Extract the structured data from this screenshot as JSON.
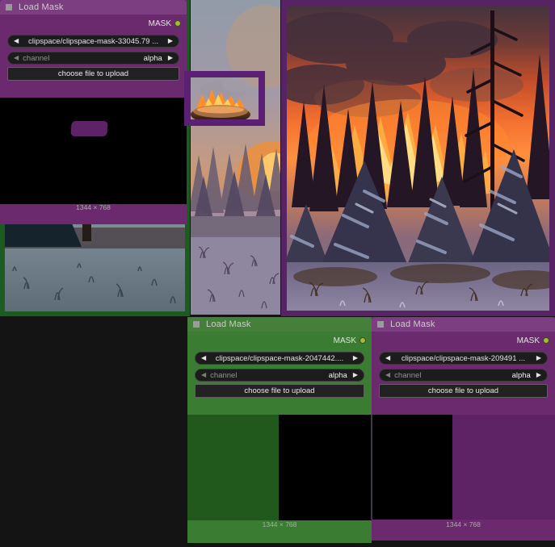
{
  "app": "ComfyUI node canvas",
  "icons": {
    "node_collapse_box": "■",
    "combo_prev_arrow": "◀",
    "combo_next_arrow": "▶"
  },
  "colors": {
    "canvas_background": "#141414",
    "node_purple_body": "#6b2a6e",
    "node_purple_title": "#7d3d81",
    "node_green_body": "#3a7c31",
    "node_green_title": "#44803a",
    "image_frame_green": "#1d5c21",
    "image_frame_purple": "#562463",
    "mask_highlight_box": "#5b2074",
    "output_dot": "#a4bb3a",
    "mask_fill": "#000000"
  },
  "images": [
    {
      "name": "snowy-forest-preview",
      "description": "snow-covered evergreen forest at dusk",
      "frame": "green"
    },
    {
      "name": "smoky-sky-ufo-preview",
      "description": "burning saucer in hazy sky over snowy brush, region outlined",
      "frame": "none"
    },
    {
      "name": "forest-fire-preview",
      "description": "forest fire with orange flames behind snow-covered conifers",
      "frame": "purple"
    }
  ],
  "nodes": [
    {
      "title": "Load Mask",
      "output_label": "MASK",
      "file_value": "clipspace/clipspace-mask-33045.79 ...",
      "channel_label": "channel",
      "channel_value": "alpha",
      "upload_label": "choose file to upload",
      "dimensions": "1344 × 768",
      "color": "purple"
    },
    {
      "title": "Load Mask",
      "output_label": "MASK",
      "file_value": "clipspace/clipspace-mask-2047442....",
      "channel_label": "channel",
      "channel_value": "alpha",
      "upload_label": "choose file to upload",
      "dimensions": "1344 × 768",
      "color": "green"
    },
    {
      "title": "Load Mask",
      "output_label": "MASK",
      "file_value": "clipspace/clipspace-mask-209491 ...",
      "channel_label": "channel",
      "channel_value": "alpha",
      "upload_label": "choose file to upload",
      "dimensions": "1344 × 768",
      "color": "purple"
    }
  ]
}
